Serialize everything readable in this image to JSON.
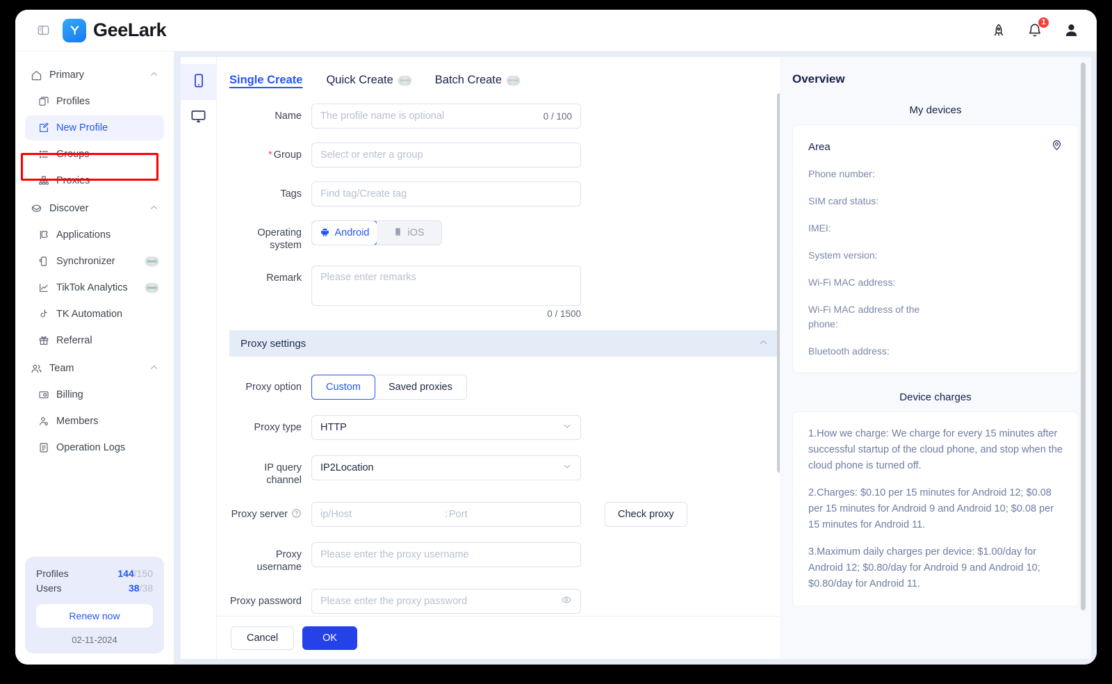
{
  "topbar": {
    "panel_toggle_icon": "panel-toggle-icon",
    "brand_name": "GeeLark",
    "rocket_icon": "rocket-icon",
    "bell_icon": "bell-icon",
    "notification_count": "1",
    "avatar_icon": "user-avatar-icon"
  },
  "sidebar": {
    "groups": [
      {
        "label": "Primary",
        "icon": "home-icon",
        "expanded": true,
        "items": [
          {
            "label": "Profiles",
            "icon": "profiles-icon",
            "badge": false,
            "active": false
          },
          {
            "label": "New Profile",
            "icon": "new-profile-icon",
            "badge": false,
            "active": true
          },
          {
            "label": "Groups",
            "icon": "groups-icon",
            "badge": false,
            "active": false
          },
          {
            "label": "Proxies",
            "icon": "proxies-icon",
            "badge": false,
            "active": false
          }
        ]
      },
      {
        "label": "Discover",
        "icon": "discover-icon",
        "expanded": true,
        "items": [
          {
            "label": "Applications",
            "icon": "applications-icon",
            "badge": false,
            "active": false
          },
          {
            "label": "Synchronizer",
            "icon": "synchronizer-icon",
            "badge": true,
            "active": false
          },
          {
            "label": "TikTok Analytics",
            "icon": "analytics-icon",
            "badge": true,
            "active": false
          },
          {
            "label": "TK Automation",
            "icon": "tiktok-icon",
            "badge": false,
            "active": false
          },
          {
            "label": "Referral",
            "icon": "gift-icon",
            "badge": false,
            "active": false
          }
        ]
      },
      {
        "label": "Team",
        "icon": "team-icon",
        "expanded": true,
        "items": [
          {
            "label": "Billing",
            "icon": "billing-icon",
            "badge": false,
            "active": false
          },
          {
            "label": "Members",
            "icon": "members-icon",
            "badge": false,
            "active": false
          },
          {
            "label": "Operation Logs",
            "icon": "logs-icon",
            "badge": false,
            "active": false
          }
        ]
      }
    ],
    "quota": {
      "profiles_label": "Profiles",
      "profiles_used": "144",
      "profiles_total": "/150",
      "users_label": "Users",
      "users_used": "38",
      "users_total": "/38",
      "renew_label": "Renew now",
      "date": "02-11-2024"
    }
  },
  "form": {
    "rail": [
      {
        "icon": "phone-icon",
        "active": true
      },
      {
        "icon": "desktop-icon",
        "active": false
      }
    ],
    "tabs": [
      {
        "label": "Single Create",
        "active": true,
        "badge": false
      },
      {
        "label": "Quick Create",
        "active": false,
        "badge": true
      },
      {
        "label": "Batch Create",
        "active": false,
        "badge": true
      }
    ],
    "name": {
      "label": "Name",
      "placeholder": "The profile name is optional",
      "value": "",
      "counter": "0 / 100"
    },
    "group": {
      "label": "Group",
      "required": "*",
      "placeholder": "Select or enter a group",
      "value": ""
    },
    "tags": {
      "label": "Tags",
      "placeholder": "Find tag/Create tag",
      "value": ""
    },
    "os": {
      "label": "Operating system",
      "options": [
        {
          "label": "Android",
          "icon": "android-icon",
          "active": true
        },
        {
          "label": "iOS",
          "icon": "apple-device-icon",
          "active": false
        }
      ]
    },
    "remark": {
      "label": "Remark",
      "placeholder": "Please enter remarks",
      "value": "",
      "counter": "0 / 1500"
    },
    "proxy_section": {
      "title": "Proxy settings",
      "chevron": "chevron-up-icon"
    },
    "proxy_option": {
      "label": "Proxy option",
      "options": [
        {
          "label": "Custom",
          "active": true
        },
        {
          "label": "Saved proxies",
          "active": false
        }
      ]
    },
    "proxy_type": {
      "label": "Proxy type",
      "value": "HTTP"
    },
    "ip_query_channel": {
      "label": "IP query channel",
      "value": "IP2Location"
    },
    "proxy_server": {
      "label": "Proxy server",
      "help_icon": "question-circle-icon",
      "host_placeholder": "ip/Host",
      "host_value": "",
      "separator": ":",
      "port_placeholder": "Port",
      "port_value": "",
      "check_label": "Check proxy"
    },
    "proxy_username": {
      "label": "Proxy username",
      "placeholder": "Please enter the proxy username",
      "value": ""
    },
    "proxy_password": {
      "label": "Proxy password",
      "placeholder": "Please enter the proxy password",
      "value": "",
      "eye_icon": "eye-icon"
    },
    "footer": {
      "cancel_label": "Cancel",
      "ok_label": "OK"
    }
  },
  "overview": {
    "title": "Overview",
    "devices_title": "My devices",
    "area_label": "Area",
    "area_pin_icon": "location-pin-icon",
    "device_fields": [
      "Phone number:",
      "SIM card status:",
      "IMEI:",
      "System version:",
      "Wi-Fi MAC address:",
      "Wi-Fi MAC address of the phone:",
      "Bluetooth address:"
    ],
    "charges_title": "Device charges",
    "charges_paragraphs": [
      "1.How we charge: We charge for every 15 minutes after successful startup of the cloud phone, and stop when the cloud phone is turned off.",
      "2.Charges: $0.10 per 15 minutes for Android 12; $0.08 per 15 minutes for Android 9 and Android 10; $0.08 per 15 minutes for Android 11.",
      "3.Maximum daily charges per device: $1.00/day for Android 12; $0.80/day for Android 9 and Android 10; $0.80/day for Android 11."
    ]
  },
  "colors": {
    "accent": "#2455f5",
    "primary_button": "#2541ea",
    "highlight_box": "#fb0000",
    "badge_red": "#f43f3f",
    "content_bg": "#e8eef7",
    "section_bg": "#e4ecf7"
  }
}
